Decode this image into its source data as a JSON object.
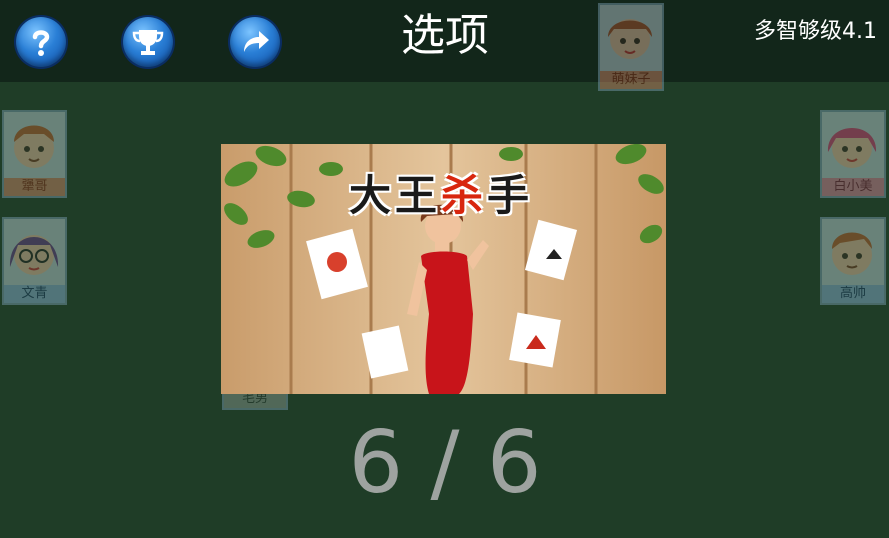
{
  "header": {
    "title": "选项",
    "level_label": "多智够级4.1",
    "help_icon": "question-icon",
    "trophy_icon": "trophy-icon",
    "share_icon": "share-arrow-icon"
  },
  "players": [
    {
      "name": "萌妹子"
    },
    {
      "name": "犟哥"
    },
    {
      "name": "白小美"
    },
    {
      "name": "文青"
    },
    {
      "name": "高帅"
    },
    {
      "name": "毛男"
    }
  ],
  "banner": {
    "title_part1": "大王",
    "title_part2": "杀",
    "title_part3": "手"
  },
  "progress": {
    "text": "6 / 6",
    "current": 6,
    "total": 6
  },
  "colors": {
    "background": "#1f3d27",
    "topbar": "#12261a",
    "button_blue": "#2a7fd6"
  }
}
